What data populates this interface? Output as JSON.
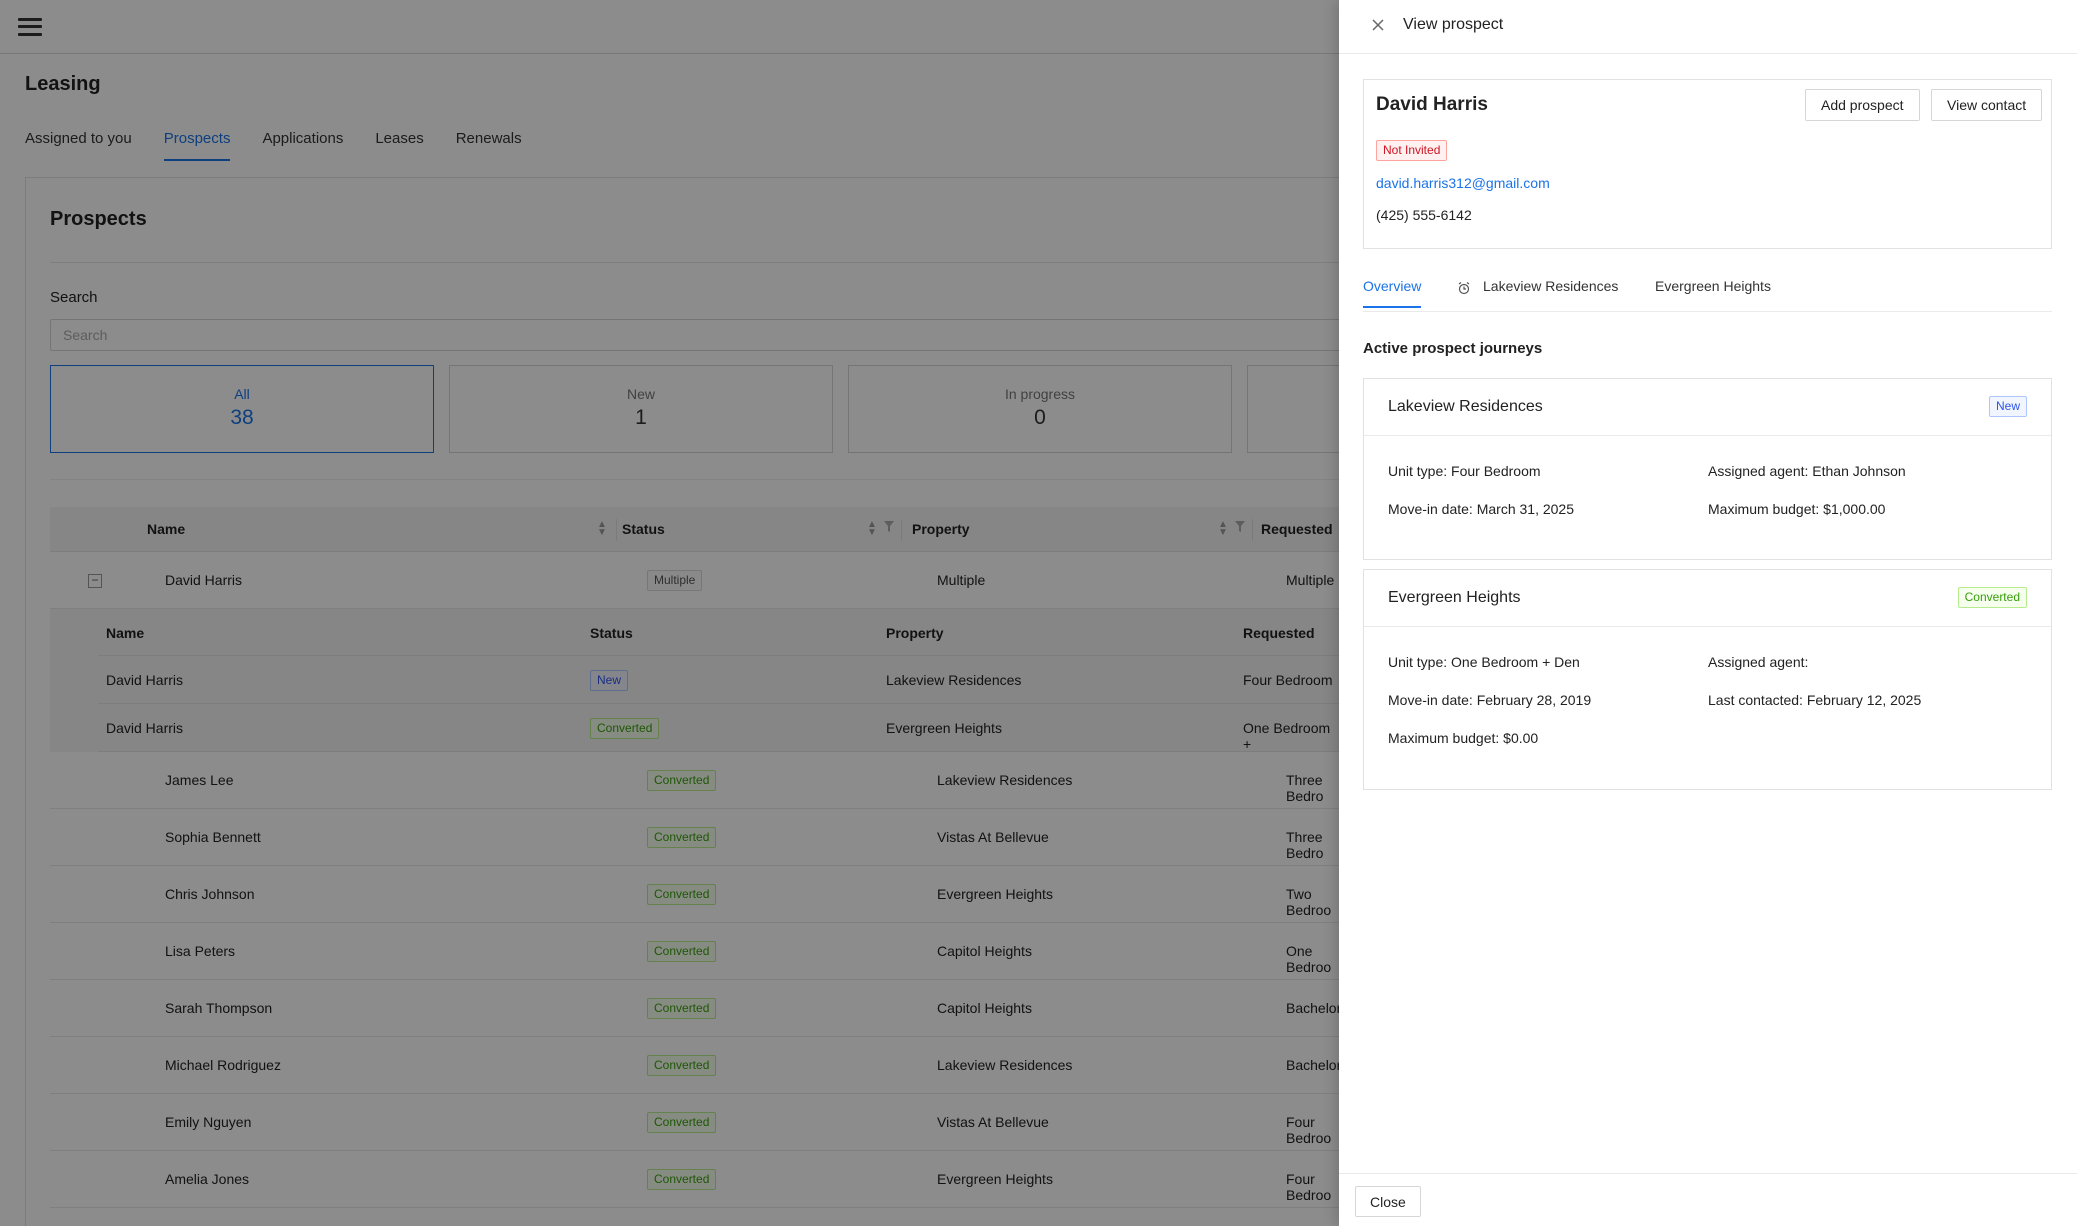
{
  "app": {
    "page_title": "Leasing",
    "tabs": [
      {
        "label": "Assigned to you"
      },
      {
        "label": "Prospects"
      },
      {
        "label": "Applications"
      },
      {
        "label": "Leases"
      },
      {
        "label": "Renewals"
      }
    ],
    "card_title": "Prospects",
    "search": {
      "label": "Search",
      "placeholder": "Search"
    },
    "stats": [
      {
        "label": "All",
        "value": "38"
      },
      {
        "label": "New",
        "value": "1"
      },
      {
        "label": "In progress",
        "value": "0"
      }
    ],
    "table": {
      "headers": {
        "name": "Name",
        "status": "Status",
        "property": "Property",
        "requested": "Requested"
      },
      "group_row": {
        "name": "David Harris",
        "status": "Multiple",
        "property": "Multiple",
        "requested": "Multiple",
        "expander": "−"
      },
      "sub_headers": {
        "name": "Name",
        "status": "Status",
        "property": "Property",
        "requested": "Requested"
      },
      "sub_rows": [
        {
          "name": "David Harris",
          "status": "New",
          "property": "Lakeview Residences",
          "requested": "Four Bedroom"
        },
        {
          "name": "David Harris",
          "status": "Converted",
          "property": "Evergreen Heights",
          "requested": "One Bedroom +"
        }
      ],
      "rows": [
        {
          "name": "James Lee",
          "status": "Converted",
          "property": "Lakeview Residences",
          "requested": "Three Bedro"
        },
        {
          "name": "Sophia Bennett",
          "status": "Converted",
          "property": "Vistas At Bellevue",
          "requested": "Three Bedro"
        },
        {
          "name": "Chris Johnson",
          "status": "Converted",
          "property": "Evergreen Heights",
          "requested": "Two Bedroo"
        },
        {
          "name": "Lisa Peters",
          "status": "Converted",
          "property": "Capitol Heights",
          "requested": "One Bedroo"
        },
        {
          "name": "Sarah Thompson",
          "status": "Converted",
          "property": "Capitol Heights",
          "requested": "Bachelor"
        },
        {
          "name": "Michael Rodriguez",
          "status": "Converted",
          "property": "Lakeview Residences",
          "requested": "Bachelor"
        },
        {
          "name": "Emily Nguyen",
          "status": "Converted",
          "property": "Vistas At Bellevue",
          "requested": "Four Bedroo"
        },
        {
          "name": "Amelia Jones",
          "status": "Converted",
          "property": "Evergreen Heights",
          "requested": "Four Bedroo"
        }
      ]
    }
  },
  "drawer": {
    "title": "View prospect",
    "profile": {
      "name": "David Harris",
      "status": "Not Invited",
      "email": "david.harris312@gmail.com",
      "phone": "(425) 555-6142",
      "add_prospect_label": "Add prospect",
      "view_contact_label": "View contact"
    },
    "tabs": [
      {
        "label": "Overview"
      },
      {
        "label": "Lakeview Residences"
      },
      {
        "label": "Evergreen Heights"
      }
    ],
    "section_title": "Active prospect journeys",
    "journeys": [
      {
        "name": "Lakeview Residences",
        "status": "New",
        "unit_type_label": "Unit type:",
        "unit_type": "Four Bedroom",
        "agent_label": "Assigned agent:",
        "agent": "Ethan Johnson",
        "move_in_label": "Move-in date:",
        "move_in": "March 31, 2025",
        "budget_label": "Maximum budget:",
        "budget": "$1,000.00"
      },
      {
        "name": "Evergreen Heights",
        "status": "Converted",
        "unit_type_label": "Unit type:",
        "unit_type": "One Bedroom + Den",
        "agent_label": "Assigned agent:",
        "agent": "",
        "move_in_label": "Move-in date:",
        "move_in": "February 28, 2019",
        "last_contacted_label": "Last contacted:",
        "last_contacted": "February 12, 2025",
        "budget_label": "Maximum budget:",
        "budget": "$0.00"
      }
    ],
    "close_label": "Close"
  },
  "colors": {
    "accent": "#1a73e8",
    "converted": "#389e0d",
    "new": "#2f54eb",
    "not_invited": "#cf1322"
  }
}
